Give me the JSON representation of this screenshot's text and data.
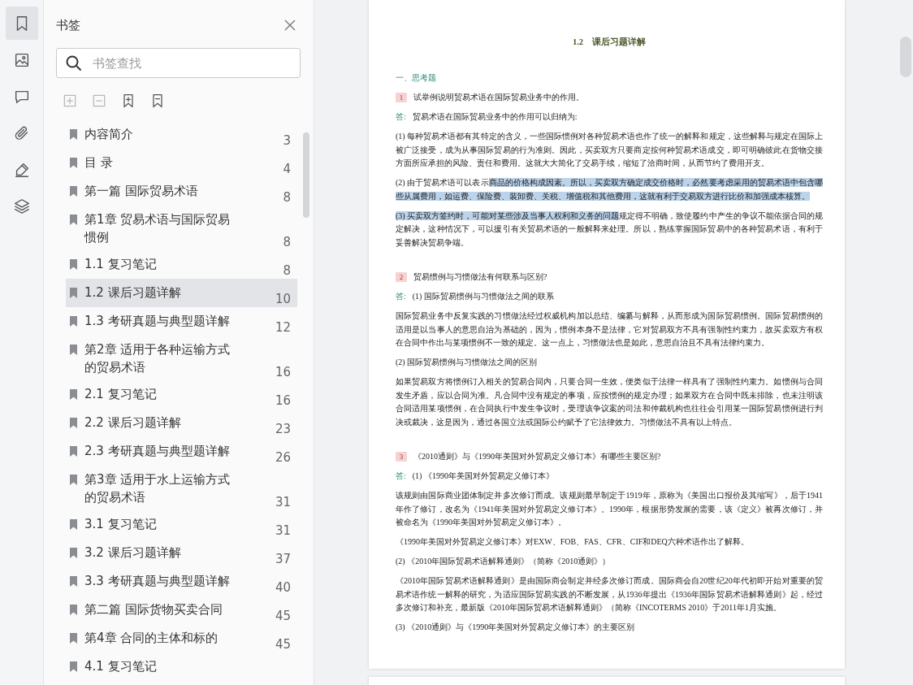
{
  "rail": {
    "items": [
      {
        "kind": "bookmark",
        "selected": true
      },
      {
        "kind": "image",
        "selected": false
      },
      {
        "kind": "comment",
        "selected": false
      },
      {
        "kind": "attachment",
        "selected": false
      },
      {
        "kind": "signature",
        "selected": false
      },
      {
        "kind": "layers",
        "selected": false
      }
    ]
  },
  "bookmarks_panel": {
    "title": "书签",
    "search": {
      "placeholder": "书签查找"
    },
    "tools": [
      {
        "kind": "add-child",
        "disabled": true
      },
      {
        "kind": "remove",
        "disabled": true
      },
      {
        "kind": "add",
        "disabled": false
      },
      {
        "kind": "bookmark",
        "disabled": false
      }
    ],
    "items": [
      {
        "label": "内容简介",
        "page": "3",
        "selected": false
      },
      {
        "label": "目 录",
        "page": "4",
        "selected": false
      },
      {
        "label": "第一篇 国际贸易术语",
        "page": "8",
        "selected": false
      },
      {
        "label": "第1章 贸易术语与国际贸易惯例",
        "page": "8",
        "selected": false
      },
      {
        "label": "1.1 复习笔记",
        "page": "8",
        "selected": false
      },
      {
        "label": "1.2 课后习题详解",
        "page": "10",
        "selected": true
      },
      {
        "label": "1.3 考研真题与典型题详解",
        "page": "12",
        "selected": false
      },
      {
        "label": "第2章 适用于各种运输方式的贸易术语",
        "page": "16",
        "selected": false
      },
      {
        "label": "2.1 复习笔记",
        "page": "16",
        "selected": false
      },
      {
        "label": "2.2 课后习题详解",
        "page": "23",
        "selected": false
      },
      {
        "label": "2.3 考研真题与典型题详解",
        "page": "26",
        "selected": false
      },
      {
        "label": "第3章 适用于水上运输方式的贸易术语",
        "page": "31",
        "selected": false
      },
      {
        "label": "3.1 复习笔记",
        "page": "31",
        "selected": false
      },
      {
        "label": "3.2 课后习题详解",
        "page": "37",
        "selected": false
      },
      {
        "label": "3.3 考研真题与典型题详解",
        "page": "40",
        "selected": false
      },
      {
        "label": "第二篇 国际货物买卖合同",
        "page": "45",
        "selected": false
      },
      {
        "label": "第4章 合同的主体和标的",
        "page": "45",
        "selected": false
      },
      {
        "label": "4.1 复习笔记",
        "selected": false
      }
    ]
  },
  "document": {
    "blocks": [
      {
        "kind": "title",
        "text": "1.2　课后习题详解"
      },
      {
        "kind": "section",
        "text": "一、思考题"
      },
      {
        "kind": "question",
        "number": "1",
        "text": "试举例说明贸易术语在国际贸易业务中的作用。"
      },
      {
        "kind": "answer",
        "label": "答:",
        "text": "贸易术语在国际贸易业务中的作用可以归纳为:"
      },
      {
        "kind": "paragraph",
        "segments": [
          {
            "text": "(1) 每种贸易术语都有其特定的含义，一些国际惯例对各种贸易术语也作了统一的解释和规定，这些解释与规定在国际上被广泛接受，成为从事国际贸易的行为准则。因此，买卖双方只要商定按何种贸易术语成交，即可明确彼此在货物交接方面所应承担的风险、责任和费用。这就大大简化了交易手续，缩短了洽商时间，从而节约了费用开支。",
            "highlighted": false
          }
        ]
      },
      {
        "kind": "paragraph",
        "segments": [
          {
            "text": "(2) 由于贸易术语可以表示",
            "highlighted": false
          },
          {
            "text": "商品的价格构成因素。所以，买卖双方确定成交价格时，必然要考虑采用的贸易术语中包含哪些从属费用，如运费、保险费、装卸费、关税、增值税和其他费用，这就有利于交易双方进行比价和加强成本核算。",
            "highlighted": true
          }
        ]
      },
      {
        "kind": "paragraph",
        "segments": [
          {
            "text": "(3) 买卖双方签约时，可能对某些涉及当事人权利和义务的问题",
            "highlighted": true
          },
          {
            "text": "规定得不明确，致使履约中产生的争议不能依据合同的规定解决，这种情况下，可以援引有关贸易术语的一般解释来处理。所以，熟练掌握国际贸易中的各种贸易术语，有利于妥善解决贸易争端。",
            "highlighted": false
          }
        ]
      },
      {
        "kind": "question",
        "number": "2",
        "text": "贸易惯例与习惯做法有何联系与区别?"
      },
      {
        "kind": "answer",
        "label": "答:",
        "text": "(1) 国际贸易惯例与习惯做法之间的联系"
      },
      {
        "kind": "paragraph",
        "segments": [
          {
            "text": "国际贸易业务中反复实践的习惯做法经过权威机构加以总结、编纂与解释，从而形成为国际贸易惯例。国际贸易惯例的适用是以当事人的意思自治为基础的，因为，惯例本身不是法律，它对贸易双方不具有强制性约束力，故买卖双方有权在合同中作出与某项惯例不一致的规定。这一点上，习惯做法也是如此，意思自治且不具有法律约束力。",
            "highlighted": false
          }
        ]
      },
      {
        "kind": "paragraph",
        "segments": [
          {
            "text": "(2) 国际贸易惯例与习惯做法之间的区别",
            "highlighted": false
          }
        ]
      },
      {
        "kind": "paragraph",
        "segments": [
          {
            "text": "如果贸易双方将惯例订入相关的贸易合同内，只要合同一生效，便类似于法律一样具有了强制性约束力。如惯例与合同发生矛盾，应以合同为准。凡合同中没有规定的事项，应按惯例的规定办理；如果双方在合同中既未排除，也未注明该合同适用某项惯例，在合同执行中发生争议时，受理该争议案的司法和仲裁机构也往往会引用某一国际贸易惯例进行判决或裁决，这是因为，通过各国立法或国际公约赋予了它法律效力。习惯做法不具有以上特点。",
            "highlighted": false
          }
        ]
      },
      {
        "kind": "question",
        "number": "3",
        "text": "《2010通则》与《1990年美国对外贸易定义修订本》有哪些主要区别?"
      },
      {
        "kind": "answer",
        "label": "答:",
        "text": "(1) 《1990年美国对外贸易定义修订本》"
      },
      {
        "kind": "paragraph",
        "segments": [
          {
            "text": "该规则由国际商业团体制定并多次修订而成。该规则最早制定于1919年，原称为《美国出口报价及其缩写》，后于1941年作了修订，改名为《1941年美国对外贸易定义修订本》。1990年，根据形势发展的需要，该《定义》被再次修订，并被命名为《1990年美国对外贸易定义修订本》。",
            "highlighted": false
          }
        ]
      },
      {
        "kind": "paragraph",
        "segments": [
          {
            "text": "《1990年美国对外贸易定义修订本》对EXW、FOB、FAS、CFR、CIF和DEQ六种术语作出了解释。",
            "highlighted": false
          }
        ]
      },
      {
        "kind": "paragraph",
        "segments": [
          {
            "text": "(2) 《2010年国际贸易术语解释通则》（简称《2010通则》）",
            "highlighted": false
          }
        ]
      },
      {
        "kind": "paragraph",
        "segments": [
          {
            "text": "《2010年国际贸易术语解释通则》是由国际商会制定并经多次修订而成。国际商会自20世纪20年代初即开始对重要的贸易术语作统一解释的研究，为适应国际贸易实践的不断发展，从1936年提出《1936年国际贸易术语解释通则》起，经过多次修订和补充，最新版《2010年国际贸易术语解释通则》（简称《INCOTERMS 2010》于2011年1月实施。",
            "highlighted": false
          }
        ]
      },
      {
        "kind": "paragraph",
        "segments": [
          {
            "text": "(3) 《2010通则》与《1990年美国对外贸易定义修订本》的主要区别",
            "highlighted": false
          }
        ]
      }
    ]
  }
}
